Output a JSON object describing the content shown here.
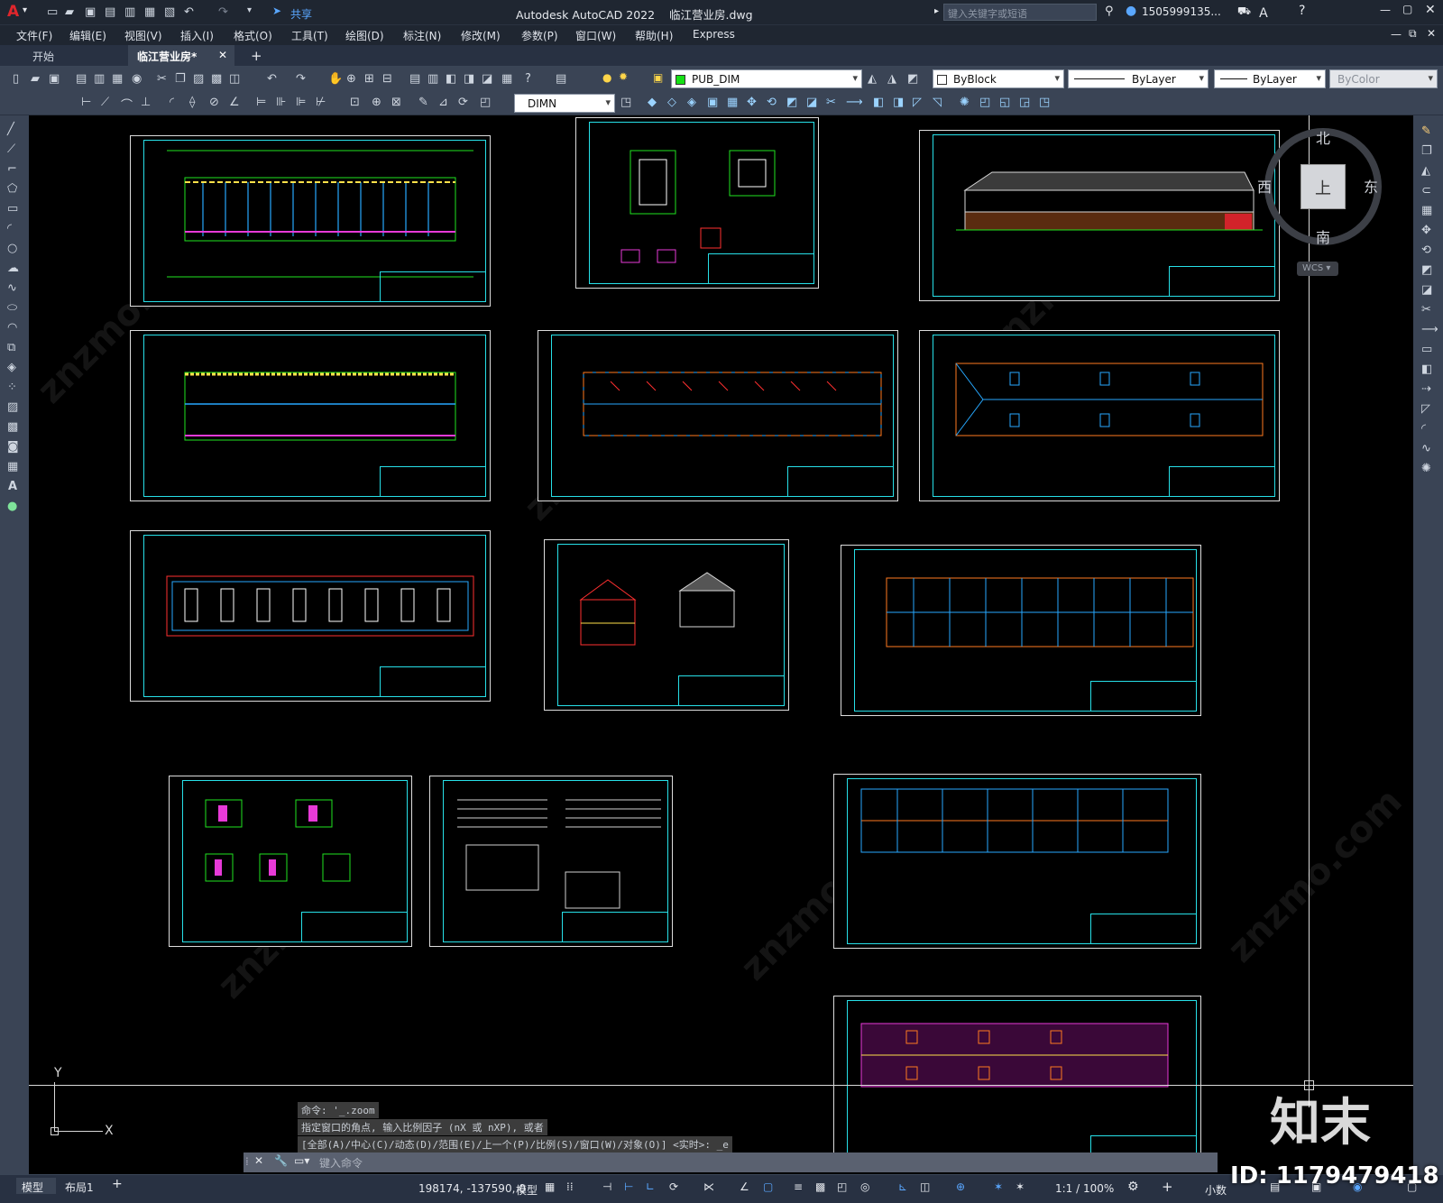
{
  "titlebar": {
    "app_logo": "A",
    "share_label": "共享",
    "title": "Autodesk AutoCAD 2022    临江营业房.dwg",
    "search_placeholder": "键入关键字或短语",
    "user": "1505999135...",
    "window_controls": [
      "minimize",
      "maximize",
      "close"
    ]
  },
  "menubar": {
    "items": [
      "文件(F)",
      "编辑(E)",
      "视图(V)",
      "插入(I)",
      "格式(O)",
      "工具(T)",
      "绘图(D)",
      "标注(N)",
      "修改(M)",
      "参数(P)",
      "窗口(W)",
      "帮助(H)",
      "Express"
    ]
  },
  "tabs": {
    "start": "开始",
    "active": "临江营业房*",
    "add": "+"
  },
  "toolbar1": {
    "layer_name": "PUB_DIM",
    "color_label": "ByBlock",
    "linetype_label": "ByLayer",
    "lineweight_label": "ByLayer",
    "plotstyle_label": "ByColor"
  },
  "toolbar2": {
    "dim_style": "DIMN"
  },
  "viewcube": {
    "north": "北",
    "south": "南",
    "east": "东",
    "west": "西",
    "top": "上",
    "wcs": "WCS"
  },
  "command": {
    "history": [
      "命令: '_.zoom",
      "指定窗口的角点, 输入比例因子 (nX 或 nXP), 或者",
      "[全部(A)/中心(C)/动态(D)/范围(E)/上一个(P)/比例(S)/窗口(W)/对象(O)] <实时>: _e"
    ],
    "placeholder": "键入命令"
  },
  "status": {
    "model_tab": "模型",
    "layout_tab": "布局1",
    "coords": "198174, -137590, 0",
    "space": "模型",
    "scale": "1:1 / 100%",
    "units": "小数"
  },
  "watermark": {
    "brand": "知末",
    "id": "ID: 1179479418"
  },
  "ucs": {
    "y": "Y",
    "x": "X"
  }
}
